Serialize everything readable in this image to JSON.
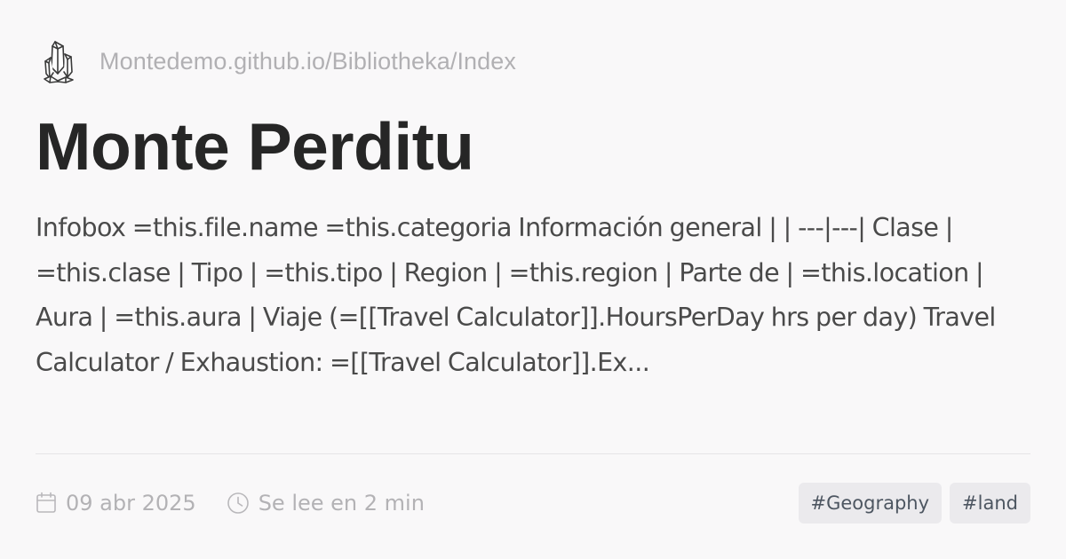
{
  "site": {
    "logo_icon": "crystal-cluster-icon",
    "url": "Montedemo.github.io/Bibliotheka/Index"
  },
  "page": {
    "title": "Monte Perditu",
    "description": "Infobox =this.file.name =this.categoria Información general | | ---|---| Clase | =this.clase | Tipo | =this.tipo | Region | =this.region | Parte de | =this.location | Aura | =this.aura | Viaje (=[[Travel Calculator]].HoursPerDay hrs per day) Travel Calculator / Exhaustion: =[[Travel Calculator]].Ex..."
  },
  "meta": {
    "date_icon": "calendar-icon",
    "date": "09 abr 2025",
    "reading_icon": "clock-icon",
    "reading_time": "Se lee en 2 min"
  },
  "tags": [
    {
      "label": "#Geography"
    },
    {
      "label": "#land"
    }
  ],
  "colors": {
    "background": "#f9f8f9",
    "title": "#262626",
    "muted": "#b3b2b5",
    "tag_background": "#ebeaed",
    "tag_text": "#4d5661"
  }
}
